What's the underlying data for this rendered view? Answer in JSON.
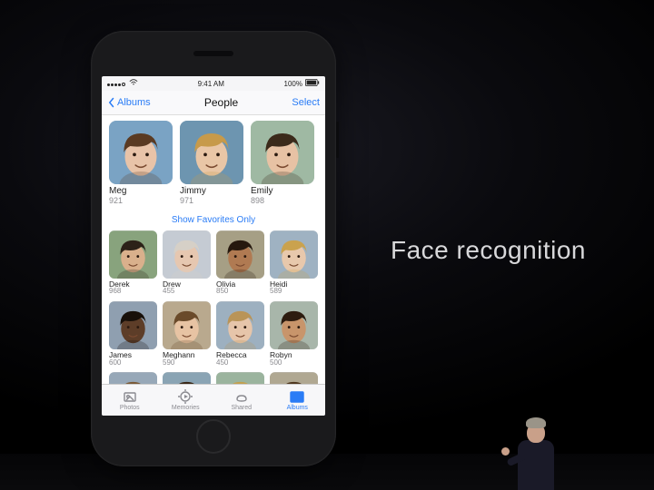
{
  "slide": {
    "title": "Face recognition"
  },
  "status": {
    "carrier": "",
    "time": "9:41 AM",
    "battery": "100%"
  },
  "nav": {
    "back_label": "Albums",
    "title": "People",
    "select_label": "Select"
  },
  "favorites_link": "Show Favorites Only",
  "favorites": [
    {
      "name": "Meg",
      "count": "921",
      "skin": "#e8c3a8",
      "hair": "#5a3a22",
      "bg": "#7aa3c4"
    },
    {
      "name": "Jimmy",
      "count": "971",
      "skin": "#e9c6a6",
      "hair": "#c79a4a",
      "bg": "#6d95b0"
    },
    {
      "name": "Emily",
      "count": "898",
      "skin": "#e7c2a4",
      "hair": "#3b2a1a",
      "bg": "#9fb9a3"
    }
  ],
  "people": [
    {
      "name": "Derek",
      "count": "968",
      "skin": "#d9b08c",
      "hair": "#2c2218",
      "bg": "#88a37d"
    },
    {
      "name": "Drew",
      "count": "455",
      "skin": "#e6c7b0",
      "hair": "#d6d0c7",
      "bg": "#c5cbd3"
    },
    {
      "name": "Olivia",
      "count": "850",
      "skin": "#b07a52",
      "hair": "#26180e",
      "bg": "#a69f85"
    },
    {
      "name": "Heidi",
      "count": "589",
      "skin": "#e8c8ac",
      "hair": "#caa24e",
      "bg": "#9fb2c2"
    },
    {
      "name": "James",
      "count": "600",
      "skin": "#5d3d28",
      "hair": "#18100a",
      "bg": "#8f9fb0"
    },
    {
      "name": "Meghann",
      "count": "590",
      "skin": "#e7c3a3",
      "hair": "#6a4a2a",
      "bg": "#b9a98e"
    },
    {
      "name": "Rebecca",
      "count": "450",
      "skin": "#e6c5aa",
      "hair": "#b99458",
      "bg": "#9db0c0"
    },
    {
      "name": "Robyn",
      "count": "500",
      "skin": "#c8956b",
      "hair": "#2d1c10",
      "bg": "#a8b6aa"
    }
  ],
  "partial_people": [
    {
      "skin": "#e2bd9e",
      "hair": "#7a5a38",
      "bg": "#97a8b8"
    },
    {
      "skin": "#e6c4a6",
      "hair": "#3a2818",
      "bg": "#8aa4b4"
    },
    {
      "skin": "#ddb698",
      "hair": "#c2a050",
      "bg": "#9bb49e"
    },
    {
      "skin": "#e4c0a2",
      "hair": "#503820",
      "bg": "#b0a892"
    }
  ],
  "tabs": [
    {
      "label": "Photos",
      "icon": "photos-icon"
    },
    {
      "label": "Memories",
      "icon": "memories-icon"
    },
    {
      "label": "Shared",
      "icon": "shared-icon"
    },
    {
      "label": "Albums",
      "icon": "albums-icon",
      "active": true
    }
  ]
}
